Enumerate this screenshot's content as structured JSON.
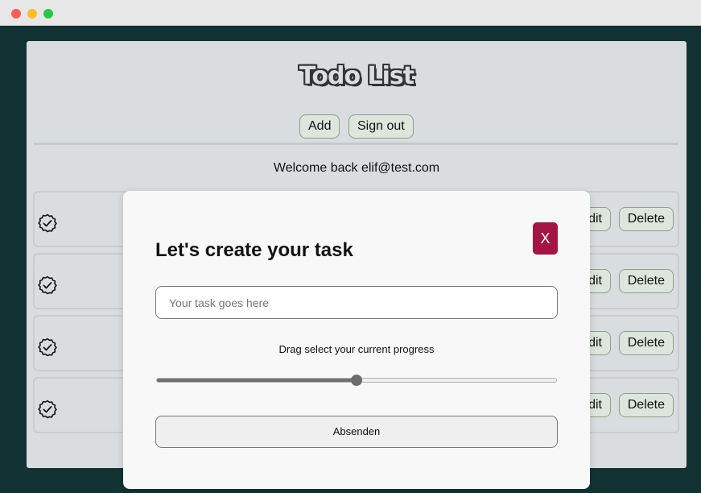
{
  "window": {
    "title": ""
  },
  "app": {
    "title": "Todo List",
    "add_label": "Add",
    "signout_label": "Sign out",
    "welcome": "Welcome back elif@test.com",
    "rows": [
      {
        "edit_label": "Edit",
        "delete_label": "Delete"
      },
      {
        "edit_label": "Edit",
        "delete_label": "Delete"
      },
      {
        "edit_label": "Edit",
        "delete_label": "Delete"
      },
      {
        "edit_label": "Edit",
        "delete_label": "Delete"
      }
    ],
    "check_icon": "check-badge-icon"
  },
  "modal": {
    "close_label": "X",
    "title": "Let's create your task",
    "input_placeholder": "Your task goes here",
    "input_value": "",
    "progress_label": "Drag select your current progress",
    "progress_value": 0.5,
    "submit_label": "Absenden"
  },
  "colors": {
    "background": "#123234",
    "card": "#d9dddf",
    "close_button": "#a31543",
    "button_border": "#8aa08a"
  }
}
